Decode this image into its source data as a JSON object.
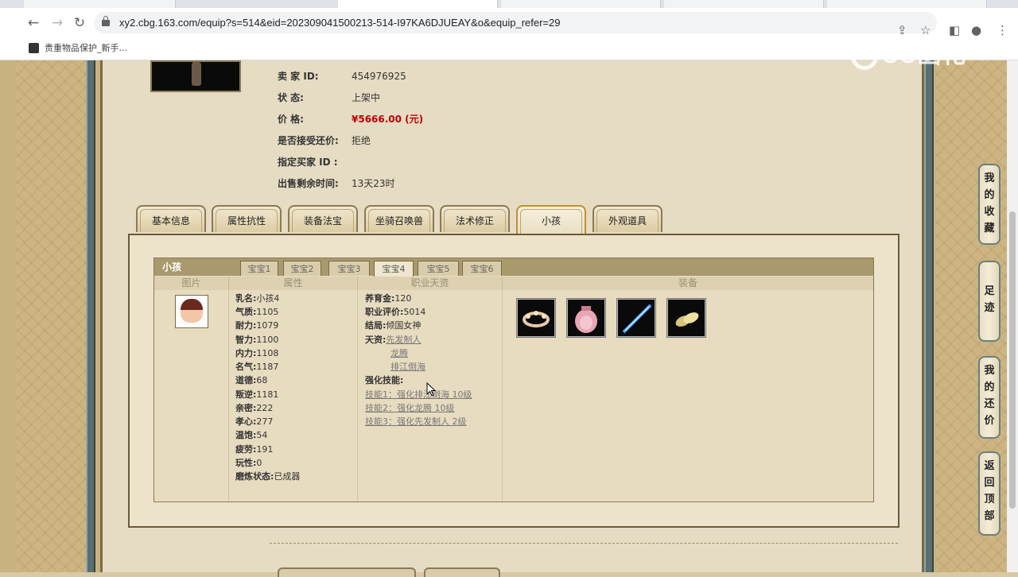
{
  "browser": {
    "url": "xy2.cbg.163.com/equip?s=514&eid=202309041500213-514-I97KA6DJUEAY&o&equip_refer=29",
    "bookmark": "贵重物品保护_新手...",
    "watermark": "CC函化"
  },
  "seller": {
    "rows": [
      {
        "label": "卖    家    ID:",
        "value": "454976925"
      },
      {
        "label": "状          态:",
        "value": "上架中"
      },
      {
        "label": "价          格:",
        "value": "¥5666.00 (元)"
      },
      {
        "label": "是否接受还价:",
        "value": "拒绝"
      },
      {
        "label": "指定买家 ID :",
        "value": ""
      },
      {
        "label": "出售剩余时间:",
        "value": "13天23时"
      }
    ]
  },
  "tabs": [
    "基本信息",
    "属性抗性",
    "装备法宝",
    "坐骑召唤兽",
    "法术修正",
    "小孩",
    "外观道具"
  ],
  "active_tab": "小孩",
  "child_panel": {
    "title": "小孩",
    "subtabs": [
      "宝宝1",
      "宝宝2",
      "宝宝3",
      "宝宝4",
      "宝宝5",
      "宝宝6"
    ],
    "active_subtab": "宝宝4",
    "columns": [
      "图片",
      "属性",
      "职业天资",
      "装备"
    ],
    "attributes": [
      {
        "k": "乳名:",
        "v": "小孩4"
      },
      {
        "k": "气质:",
        "v": "1105"
      },
      {
        "k": "耐力:",
        "v": "1079"
      },
      {
        "k": "智力:",
        "v": "1100"
      },
      {
        "k": "内力:",
        "v": "1108"
      },
      {
        "k": "名气:",
        "v": "1187"
      },
      {
        "k": "道德:",
        "v": "68"
      },
      {
        "k": "叛逆:",
        "v": "1181"
      },
      {
        "k": "亲密:",
        "v": "222"
      },
      {
        "k": "孝心:",
        "v": "277"
      },
      {
        "k": "温饱:",
        "v": "54"
      },
      {
        "k": "疲劳:",
        "v": "191"
      },
      {
        "k": "玩性:",
        "v": "0"
      },
      {
        "k": "磨炼状态:",
        "v": "已成器"
      }
    ],
    "career": {
      "yangyujin_label": "养育金:",
      "yangyujin": "120",
      "pingjia_label": "职业评价:",
      "pingjia": "5014",
      "jieju_label": "结局:",
      "jieju": "倾国女神",
      "tianzi_label": "天资:",
      "tianzi": [
        "先发制人",
        "龙腾",
        "排江倒海"
      ],
      "skills_label": "强化技能:",
      "skills": [
        "技能1：强化排江倒海 10级",
        "技能2：强化龙腾 10级",
        "技能3：强化先发制人 2级"
      ]
    },
    "equipment_icons": [
      "flower-crown-icon",
      "pink-pouch-icon",
      "blue-sword-icon",
      "golden-shoes-icon"
    ]
  },
  "side_buttons": [
    {
      "chars": [
        "我",
        "的",
        "收",
        "藏"
      ]
    },
    {
      "chars": [
        "足",
        "迹"
      ]
    },
    {
      "chars": [
        "我",
        "的",
        "还",
        "价"
      ]
    },
    {
      "chars": [
        "返",
        "回",
        "顶",
        "部"
      ]
    }
  ]
}
